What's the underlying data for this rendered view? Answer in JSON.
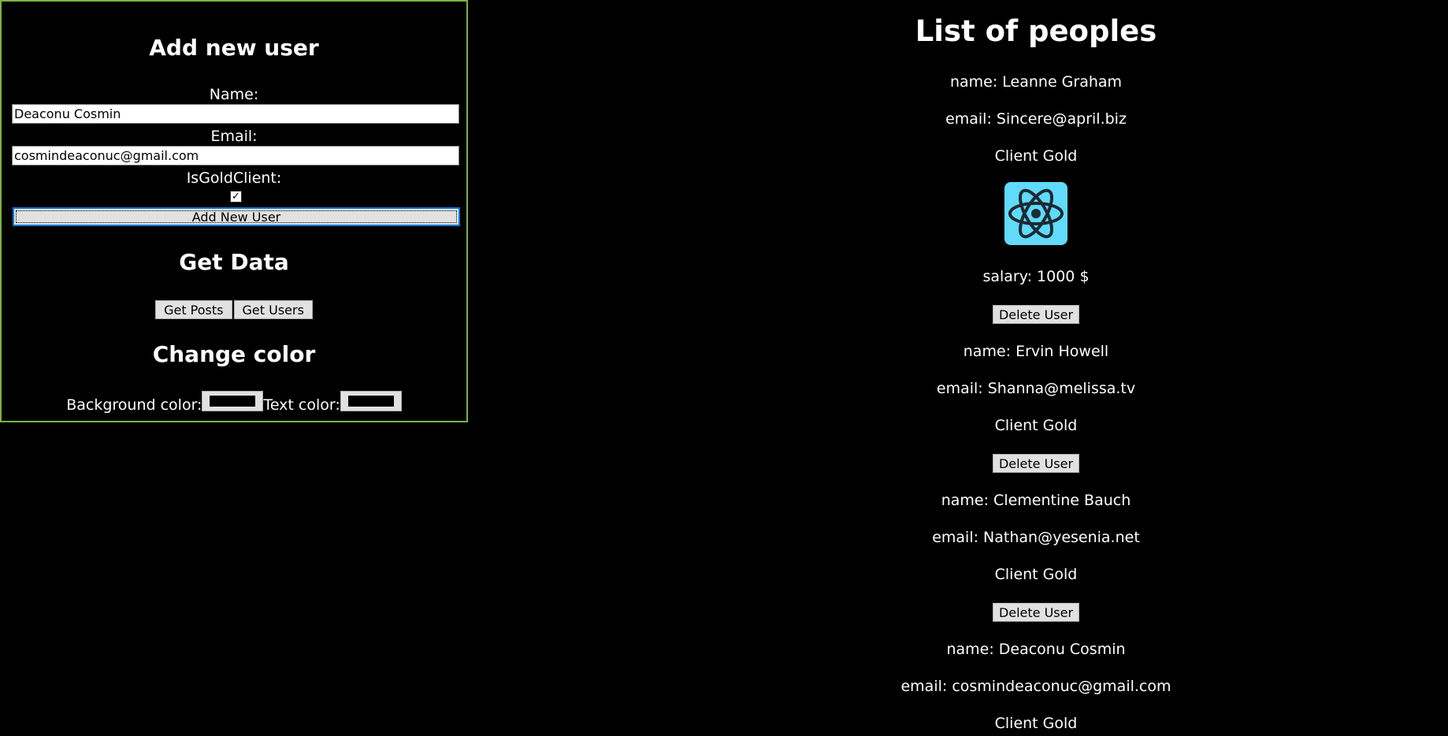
{
  "form": {
    "title": "Add new user",
    "name_label": "Name:",
    "name_value": "Deaconu Cosmin",
    "email_label": "Email:",
    "email_value": "cosmindeaconuc@gmail.com",
    "gold_label": "IsGoldClient:",
    "gold_checked": true,
    "add_button": "Add New User"
  },
  "get_data": {
    "title": "Get Data",
    "posts_button": "Get Posts",
    "users_button": "Get Users"
  },
  "change_color": {
    "title": "Change color",
    "background_label": "Background color:",
    "text_label": "Text color:",
    "background_value": "#000000",
    "text_value": "#000000"
  },
  "list": {
    "title": "List of peoples",
    "users": [
      {
        "name": "name: Leanne Graham",
        "email": "email: Sincere@april.biz",
        "client": "Client Gold",
        "salary": "salary: 1000 $",
        "delete": "Delete User"
      },
      {
        "name": "name: Ervin Howell",
        "email": "email: Shanna@melissa.tv",
        "client": "Client Gold",
        "delete": "Delete User"
      },
      {
        "name": "name: Clementine Bauch",
        "email": "email: Nathan@yesenia.net",
        "client": "Client Gold",
        "delete": "Delete User"
      },
      {
        "name": "name: Deaconu Cosmin",
        "email": "email: cosmindeaconuc@gmail.com",
        "client": "Client Gold"
      }
    ],
    "logo_icon": "react-icon",
    "logo_color": "#61dafb"
  },
  "colors": {
    "background": "#000000",
    "text": "#ffffff",
    "panel_border": "#7cb342",
    "button_bg": "#e1e1e1",
    "focus_border": "#0078d7"
  }
}
